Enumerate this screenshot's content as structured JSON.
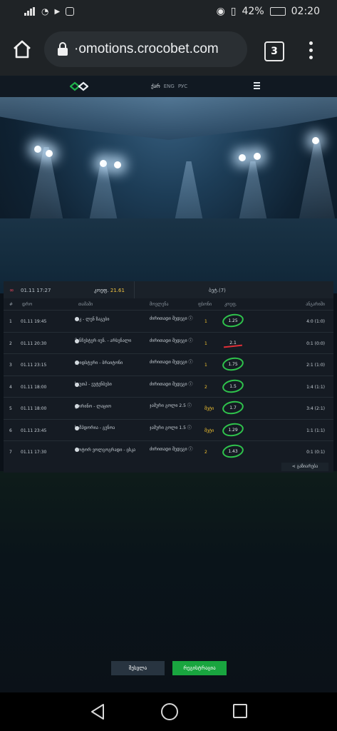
{
  "status_bar": {
    "battery": "42%",
    "time": "02:20"
  },
  "browser": {
    "url": "·omotions.crocobet.com",
    "tab_count": "3"
  },
  "site": {
    "languages": [
      "ქარ",
      "ENG",
      "РУС"
    ]
  },
  "ticket": {
    "datetime": "01.11 17:27",
    "coef_label": "კოეფ.",
    "coef_value": "21.61",
    "bets_label": "ბეტ.(7)",
    "columns": {
      "num": "#",
      "date": "დრო",
      "teams": "თამაში",
      "market": "მოვლენა",
      "pick": "ფსონი",
      "odd": "კოეფ.",
      "result": "ანგარიში"
    },
    "rows": [
      {
        "num": "1",
        "date": "01.11 19:45",
        "teams": "აიკ - ლენ ზაგები",
        "market": "ძირითადი შედეგი ⓘ",
        "pick": "1",
        "odd": "1.25",
        "odd_status": "won",
        "result": "4:0 (1:0)"
      },
      {
        "num": "2",
        "date": "01.11 20:30",
        "teams": "მანჩესტერ იუნ. - არსენალი",
        "market": "ძირითადი შედეგი ⓘ",
        "pick": "1",
        "odd": "2.1",
        "odd_status": "lost",
        "result": "0:1 (0:0)"
      },
      {
        "num": "3",
        "date": "01.11 23:15",
        "teams": "ლიდსტერი - ბრაიტონი",
        "market": "ძირითადი შედეგი ⓘ",
        "pick": "1",
        "odd": "1.75",
        "odd_status": "won",
        "result": "2:1 (1:0)"
      },
      {
        "num": "4",
        "date": "01.11 18:00",
        "teams": "საუთჰ - ეუტენბესი",
        "market": "ძირითადი შედეგი ⓘ",
        "pick": "2",
        "odd": "1.5",
        "odd_status": "won",
        "result": "1:4 (1:1)"
      },
      {
        "num": "5",
        "date": "01.11 18:00",
        "teams": "ტორინო - ლაციო",
        "market": "ჯამური გოლი 2.5 ⓘ",
        "pick": "მეტი",
        "odd": "1.7",
        "odd_status": "won",
        "result": "3:4 (2:1)"
      },
      {
        "num": "6",
        "date": "01.11 23:45",
        "teams": "სამპდორია - გენოა",
        "market": "ჯამური გოლი 1.5 ⓘ",
        "pick": "მეტი",
        "odd": "1.29",
        "odd_status": "won",
        "result": "1:1 (1:1)"
      },
      {
        "num": "7",
        "date": "01.11 17:30",
        "teams": "როტორ ვოლგოგრადი - ცსკა",
        "market": "ძირითადი შედეგი ⓘ",
        "pick": "2",
        "odd": "1.43",
        "odd_status": "won",
        "result": "0:1 (0:1)"
      }
    ],
    "share_label": "გაზიარება"
  },
  "actions": {
    "login": "შესვლა",
    "register": "რეგისტრაცია"
  },
  "colors": {
    "accent_green": "#19a53f",
    "won_ring": "#2fc44c",
    "lost_strike": "#e02f37",
    "coef_yellow": "#f4c542"
  }
}
